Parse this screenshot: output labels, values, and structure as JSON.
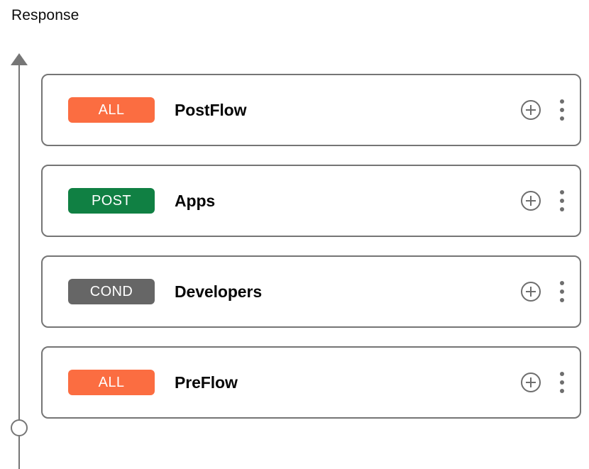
{
  "header": {
    "title": "Response"
  },
  "colors": {
    "badge_all": "#fb6d41",
    "badge_post": "#108043",
    "badge_cond": "#666666",
    "card_border": "#757575",
    "rail": "#767676",
    "icon": "#6e6e6e",
    "text": "#070707"
  },
  "rail": {
    "arrow_icon": "arrow-up-icon",
    "endpoint_icon": "circle-endpoint-icon"
  },
  "flow": {
    "items": [
      {
        "badge": "ALL",
        "badge_type": "all",
        "label": "PostFlow",
        "add_icon": "plus-circle-icon",
        "menu_icon": "kebab-menu-icon"
      },
      {
        "badge": "POST",
        "badge_type": "post",
        "label": "Apps",
        "add_icon": "plus-circle-icon",
        "menu_icon": "kebab-menu-icon"
      },
      {
        "badge": "COND",
        "badge_type": "cond",
        "label": "Developers",
        "add_icon": "plus-circle-icon",
        "menu_icon": "kebab-menu-icon"
      },
      {
        "badge": "ALL",
        "badge_type": "all",
        "label": "PreFlow",
        "add_icon": "plus-circle-icon",
        "menu_icon": "kebab-menu-icon"
      }
    ]
  }
}
